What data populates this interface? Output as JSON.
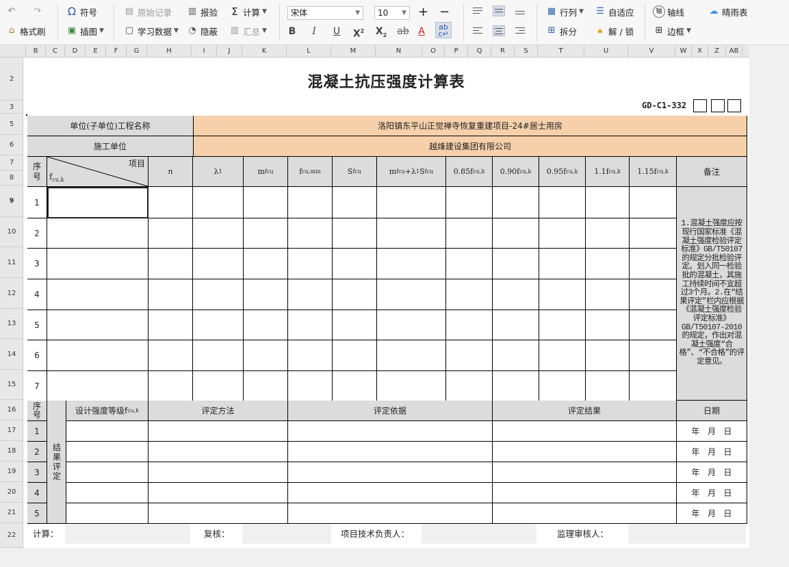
{
  "toolbar": {
    "undo": "undo-icon",
    "redo": "redo-icon",
    "format_painter": "格式刷",
    "symbol": "符号",
    "insert_image": "插图",
    "raw_record": "原始记录",
    "learn_data": "学习数据",
    "report_check": "报验",
    "hide": "隐蔽",
    "calc": "计算",
    "summary": "汇总",
    "font_name": "宋体",
    "font_size": "10",
    "row_col": "行列",
    "split": "拆分",
    "auto_fit": "自适应",
    "unlock": "解 / 锁",
    "axis": "轴线",
    "border": "边框",
    "weather": "晴雨表"
  },
  "columns": [
    "B",
    "C",
    "D",
    "E",
    "F",
    "G",
    "H",
    "I",
    "J",
    "K",
    "L",
    "M",
    "N",
    "O",
    "P",
    "Q",
    "R",
    "S",
    "T",
    "U",
    "V",
    "W",
    "X",
    "Z",
    "AB"
  ],
  "rows": [
    "2",
    "3",
    "5",
    "6",
    "7",
    "8",
    "9",
    "10",
    "11",
    "12",
    "13",
    "14",
    "15",
    "16",
    "17",
    "18",
    "19",
    "20",
    "21",
    "22"
  ],
  "form": {
    "title": "混凝土抗压强度计算表",
    "code": "GD-C1-332",
    "project_label": "单位(子单位)工程名称",
    "project_value": "洛阳镇东平山正觉禅寺恢复重建项目-24#居士用房",
    "builder_label": "施工单位",
    "builder_value": "越烽建设集团有限公司",
    "seq_label": "序号",
    "item_label": "项目",
    "fcuk": "f",
    "fcuk_sub": "cu,k",
    "n_label": "n",
    "lambda1": "λ",
    "lambda1_sub": "1",
    "mfcu": "m",
    "mfcu_sub": "fcu",
    "fcumin": "f",
    "fcumin_sub": "cu,min",
    "sfcu": "S",
    "sfcu_sub": "fcu",
    "combo_a": "m",
    "combo_a_sub": "fcu",
    "combo_b": "+λ",
    "combo_b_sub": "1",
    "combo_c": "S",
    "combo_c_sub": "fcu",
    "k085": "0.85f",
    "k090": "0.90f",
    "k095": "0.95f",
    "k11": "1.1f",
    "k115": "1.15f",
    "k_sub": "cu,k",
    "remark_label": "备注",
    "remark_text": "1.混凝土强度应按现行国家标准《混凝土强度检验评定标准》GB/T50107的规定分批检验评定。划入同一检验批的混凝土，其施工持续时间不宜超过3个月。2.在“结果评定”栏内应根据《混凝土强度检验评定标准》GB/T50107-2010的规定，作出对混凝土强度“合格”、“不合格”的评定意见。",
    "data_rows": [
      "1",
      "2",
      "3",
      "4",
      "5",
      "6",
      "7"
    ],
    "result_label": "结果评定",
    "design_grade": "设计强度等级f",
    "design_grade_sub": "cu,k",
    "eval_method": "评定方法",
    "eval_basis": "评定依据",
    "eval_result": "评定结果",
    "date_label": "日期",
    "result_rows": [
      "1",
      "2",
      "3",
      "4",
      "5"
    ],
    "date_text": "年   月   日",
    "calc_label": "计算：",
    "review_label": "复核：",
    "tech_lead_label": "项目技术负责人：",
    "supervisor_label": "监理审核人："
  }
}
